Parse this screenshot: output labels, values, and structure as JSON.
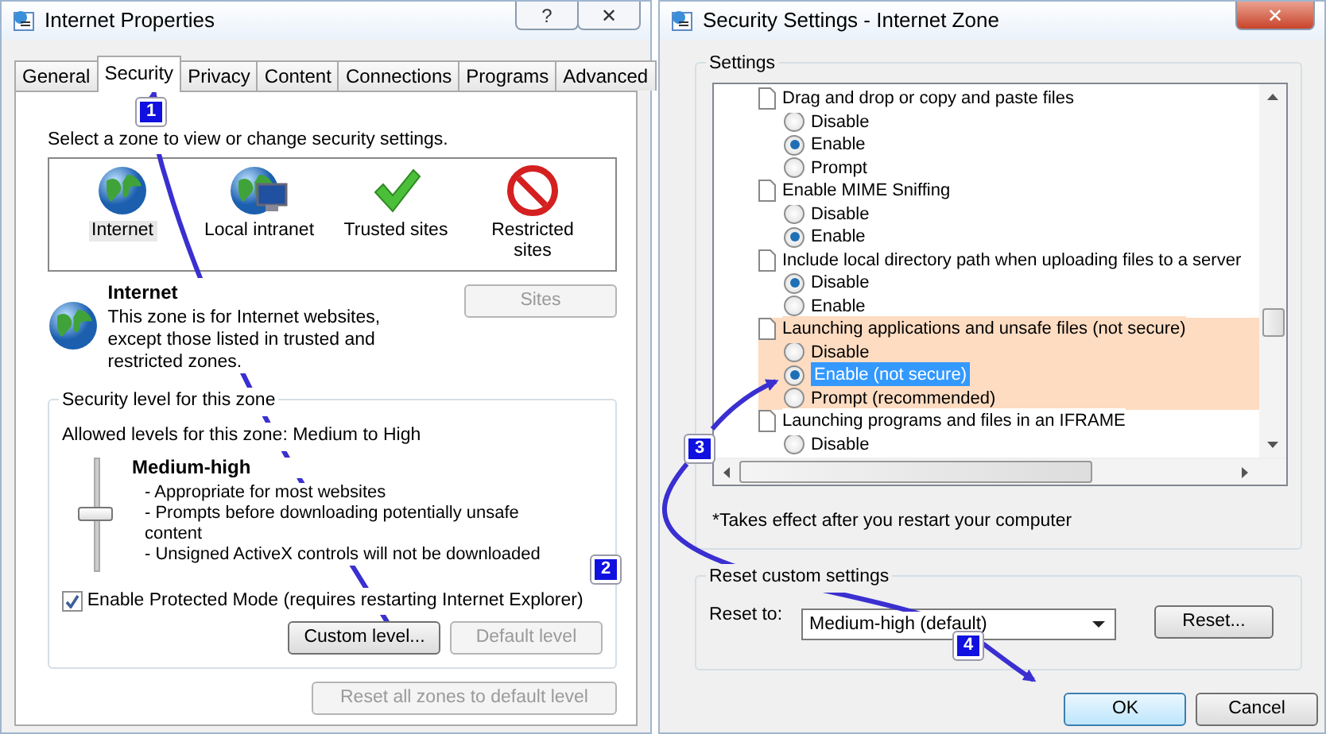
{
  "left_window": {
    "title": "Internet Properties",
    "help_glyph": "?",
    "close_glyph": "✕",
    "tabs": [
      {
        "label": "General",
        "selected": false
      },
      {
        "label": "Security",
        "selected": true
      },
      {
        "label": "Privacy",
        "selected": false
      },
      {
        "label": "Content",
        "selected": false
      },
      {
        "label": "Connections",
        "selected": false
      },
      {
        "label": "Programs",
        "selected": false
      },
      {
        "label": "Advanced",
        "selected": false
      }
    ],
    "zone_prompt": "Select a zone to view or change security settings.",
    "zones": [
      {
        "label": "Internet",
        "kind": "globe",
        "selected": true
      },
      {
        "label": "Local intranet",
        "kind": "intranet",
        "selected": false
      },
      {
        "label": "Trusted sites",
        "kind": "check",
        "selected": false
      },
      {
        "label": "Restricted sites",
        "kind": "blocked",
        "selected": false
      }
    ],
    "zone_info": {
      "name": "Internet",
      "description": "This zone is for Internet websites, except those listed in trusted and restricted zones."
    },
    "sites_button": {
      "label": "Sites",
      "disabled": true
    },
    "security_level": {
      "legend": "Security level for this zone",
      "allowed": "Allowed levels for this zone: Medium to High",
      "level": 0.5,
      "level_name": "Medium-high",
      "bullets": [
        "- Appropriate for most websites",
        "- Prompts before downloading potentially unsafe content",
        "- Unsigned ActiveX controls will not be downloaded"
      ]
    },
    "protected_mode": {
      "label": "Enable Protected Mode (requires restarting Internet Explorer)",
      "checked": true
    },
    "level_buttons": [
      {
        "label": "Custom level...",
        "disabled": false
      },
      {
        "label": "Default level",
        "disabled": true
      }
    ],
    "reset_all": {
      "label": "Reset all zones to default level",
      "disabled": true
    }
  },
  "right_window": {
    "title": "Security Settings - Internet Zone",
    "close_glyph": "✕",
    "settings_legend": "Settings",
    "settings": [
      {
        "label": "Drag and drop or copy and paste files",
        "highlighted": false,
        "options": [
          {
            "label": "Disable",
            "selected": false,
            "focused": false
          },
          {
            "label": "Enable",
            "selected": true,
            "focused": false
          },
          {
            "label": "Prompt",
            "selected": false,
            "focused": false
          }
        ]
      },
      {
        "label": "Enable MIME Sniffing",
        "highlighted": false,
        "options": [
          {
            "label": "Disable",
            "selected": false,
            "focused": false
          },
          {
            "label": "Enable",
            "selected": true,
            "focused": false
          }
        ]
      },
      {
        "label": "Include local directory path when uploading files to a server",
        "highlighted": false,
        "options": [
          {
            "label": "Disable",
            "selected": true,
            "focused": false
          },
          {
            "label": "Enable",
            "selected": false,
            "focused": false
          }
        ]
      },
      {
        "label": "Launching applications and unsafe files (not secure)",
        "highlighted": true,
        "options": [
          {
            "label": "Disable",
            "selected": false,
            "focused": false
          },
          {
            "label": "Enable (not secure)",
            "selected": true,
            "focused": true
          },
          {
            "label": "Prompt (recommended)",
            "selected": false,
            "focused": false
          }
        ]
      },
      {
        "label": "Launching programs and files in an IFRAME",
        "highlighted": false,
        "options": [
          {
            "label": "Disable",
            "selected": false,
            "focused": false
          }
        ]
      }
    ],
    "note": "*Takes effect after you restart your computer",
    "reset_legend": "Reset custom settings",
    "reset_label": "Reset to:",
    "reset_value": "Medium-high (default)",
    "reset_button": "Reset...",
    "buttons": [
      {
        "label": "OK",
        "default": true
      },
      {
        "label": "Cancel",
        "default": false
      }
    ]
  },
  "callouts": [
    "1",
    "2",
    "3",
    "4"
  ]
}
